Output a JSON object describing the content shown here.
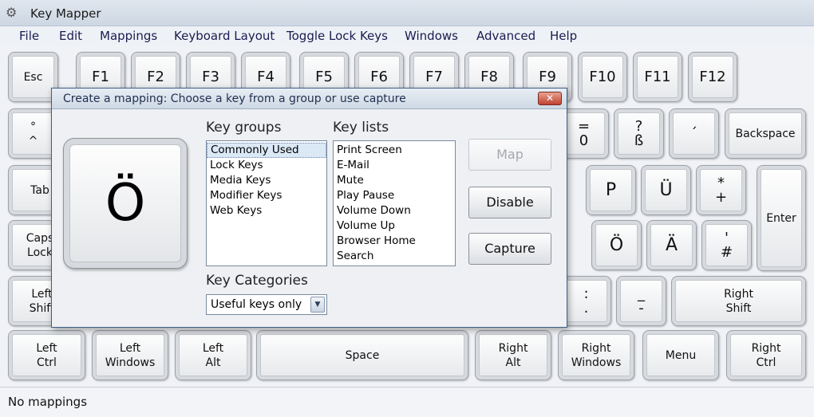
{
  "window": {
    "title": "Key Mapper",
    "icon": "gear-icon"
  },
  "menu": [
    "File",
    "Edit",
    "Mappings",
    "Keyboard Layout",
    "Toggle Lock Keys",
    "Windows",
    "Advanced",
    "Help"
  ],
  "keys": {
    "esc": "Esc",
    "f1": "F1",
    "f2": "F2",
    "f3": "F3",
    "f4": "F4",
    "f5": "F5",
    "f6": "F6",
    "f7": "F7",
    "f8": "F8",
    "f9": "F9",
    "f10": "F10",
    "f11": "F11",
    "f12": "F12",
    "caret": "°\n^",
    "equals": "=\n0",
    "question": "?\nß",
    "accent": "´",
    "backspace": "Backspace",
    "tab": "Tab",
    "p": "P",
    "u_umlaut": "Ü",
    "asterisk": "*\n+",
    "enter": "Enter",
    "caps": "Caps\nLock",
    "o_umlaut": "Ö",
    "a_umlaut": "Ä",
    "hash": "'\n#",
    "left_shift": "Left\nShift",
    "colon": ":\n.",
    "underscore": "_\n-",
    "right_shift": "Right\nShift",
    "left_ctrl": "Left\nCtrl",
    "left_windows": "Left\nWindows",
    "left_alt": "Left\nAlt",
    "space": "Space",
    "right_alt": "Right\nAlt",
    "right_windows": "Right\nWindows",
    "menu": "Menu",
    "right_ctrl": "Right\nCtrl"
  },
  "dialog": {
    "title": "Create a mapping: Choose a key from a group or use capture",
    "close_symbol": "✕",
    "selected_key": "Ö",
    "groups_label": "Key groups",
    "groups": [
      "Commonly Used",
      "Lock Keys",
      "Media Keys",
      "Modifier Keys",
      "Web Keys"
    ],
    "selected_group": "Commonly Used",
    "lists_label": "Key lists",
    "keys": [
      "Print Screen",
      "E-Mail",
      "Mute",
      "Play Pause",
      "Volume Down",
      "Volume Up",
      "Browser Home",
      "Search"
    ],
    "categories_label": "Key Categories",
    "category_value": "Useful keys only",
    "buttons": {
      "map": "Map",
      "disable": "Disable",
      "capture": "Capture"
    }
  },
  "status": "No mappings"
}
